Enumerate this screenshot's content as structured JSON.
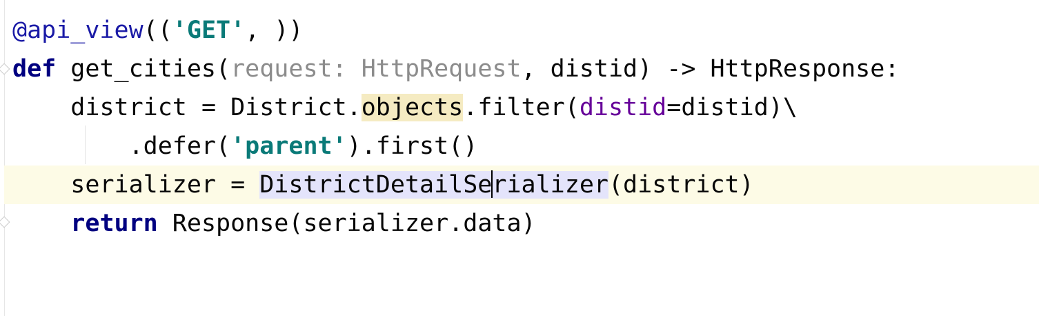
{
  "code": {
    "line1": {
      "decorator": "@api_view",
      "open": "((",
      "string": "'GET'",
      "close": ", ))"
    },
    "line2": {
      "keyword": "def",
      "name": " get_cities(",
      "param_hint": "request: HttpRequest",
      "rest": ", distid) -> HttpResponse:"
    },
    "line3": {
      "indent": "    ",
      "lhs": "district = District.",
      "highlight": "objects",
      "mid": ".filter(",
      "named_arg": "distid",
      "rest": "=distid)\\"
    },
    "line4": {
      "indent": "        ",
      "method": ".defer(",
      "string": "'parent'",
      "rest": ").first()"
    },
    "line5": {
      "indent": "    ",
      "lhs": "serializer = ",
      "symbol_before_caret": "DistrictDetailSe",
      "symbol_after_caret": "rializer",
      "rest": "(district)"
    },
    "line6": {
      "indent": "    ",
      "keyword": "return",
      "rest": " Response(serializer.data)"
    }
  },
  "colors": {
    "background": "#ffffff",
    "current_line": "#fdfbe6",
    "keyword": "#000080",
    "decorator": "#1a1aa6",
    "string": "#067d17",
    "param_hint": "#8c8c8c",
    "named_arg": "#660099",
    "usage_highlight": "#f5ebc2",
    "symbol_highlight": "#e4e4fb"
  }
}
